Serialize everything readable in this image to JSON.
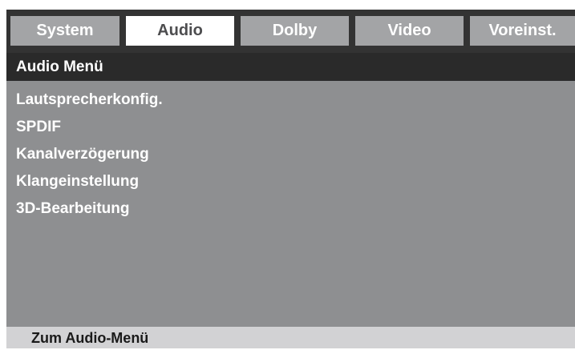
{
  "tabs": [
    {
      "label": "System",
      "active": false
    },
    {
      "label": "Audio",
      "active": true
    },
    {
      "label": "Dolby",
      "active": false
    },
    {
      "label": "Video",
      "active": false
    },
    {
      "label": "Voreinst.",
      "active": false
    }
  ],
  "menu": {
    "title": "Audio Menü",
    "items": [
      {
        "label": "Lautsprecherkonfig."
      },
      {
        "label": "SPDIF"
      },
      {
        "label": "Kanalverzögerung"
      },
      {
        "label": "Klangeinstellung"
      },
      {
        "label": "3D-Bearbeitung"
      }
    ]
  },
  "status": {
    "hint": "Zum Audio-Menü"
  },
  "colors": {
    "background": "#8e8f91",
    "tab_bar": "#333333",
    "tab_inactive": "#a3a4a6",
    "tab_active": "#ffffff",
    "title_bar": "#2a2a2a",
    "status_bar": "#d2d2d4"
  }
}
